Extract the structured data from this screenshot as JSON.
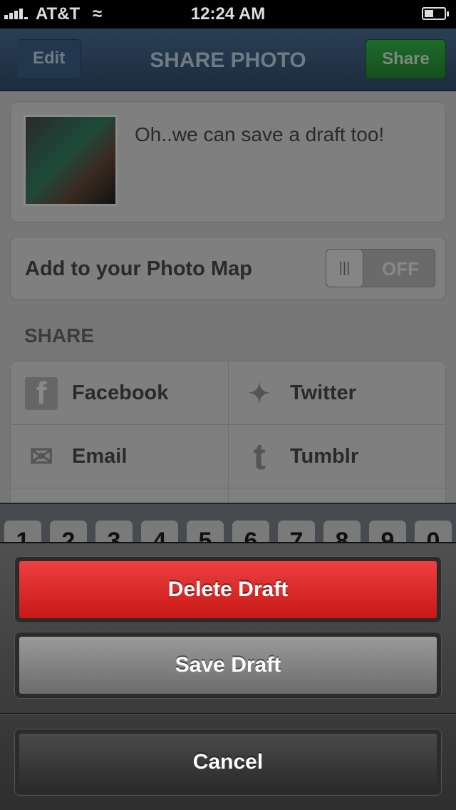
{
  "status_bar": {
    "carrier": "AT&T",
    "time": "12:24 AM",
    "wifi_icon": "wifi-icon",
    "battery_icon": "battery-icon"
  },
  "nav": {
    "back_label": "Edit",
    "title": "SHARE PHOTO",
    "share_label": "Share",
    "share_color": "#1f6b2a"
  },
  "caption": {
    "text": "Oh..we can save a draft too!"
  },
  "photo_map": {
    "label": "Add to your Photo Map",
    "toggle_state": "OFF"
  },
  "share": {
    "section_label": "SHARE",
    "items": [
      {
        "label": "Facebook",
        "icon": "facebook-icon"
      },
      {
        "label": "Twitter",
        "icon": "twitter-icon"
      },
      {
        "label": "Email",
        "icon": "email-icon"
      },
      {
        "label": "Tumblr",
        "icon": "tumblr-icon"
      }
    ]
  },
  "keyboard": {
    "keys": [
      "1",
      "2",
      "3",
      "4",
      "5",
      "6",
      "7",
      "8",
      "9",
      "0"
    ]
  },
  "action_sheet": {
    "delete_label": "Delete Draft",
    "save_label": "Save Draft",
    "cancel_label": "Cancel",
    "delete_color": "#d42020"
  }
}
